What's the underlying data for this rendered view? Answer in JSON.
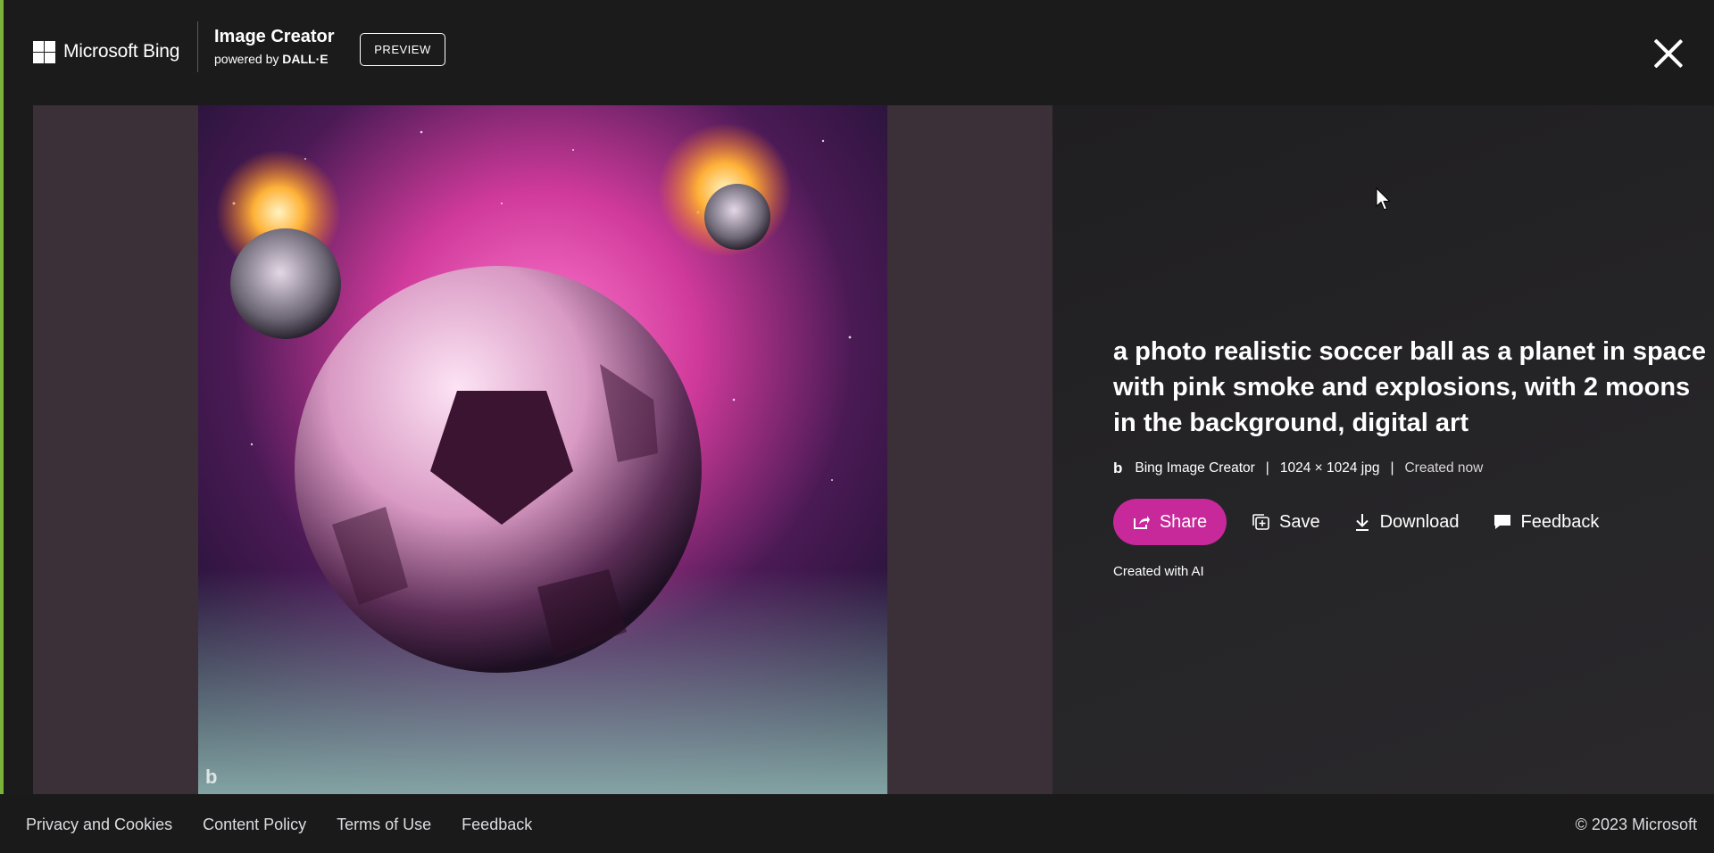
{
  "header": {
    "brand": "Microsoft Bing",
    "product_title": "Image Creator",
    "product_sub_prefix": "powered by ",
    "product_sub_brand": "DALL·E",
    "preview_badge": "PREVIEW"
  },
  "image": {
    "watermark": "b"
  },
  "details": {
    "prompt": "a photo realistic soccer ball as a planet in space with pink smoke and explosions, with 2 moons in the background, digital art",
    "meta": {
      "source": "Bing Image Creator",
      "separator": "|",
      "dimensions": "1024 × 1024 jpg",
      "created": "Created now"
    },
    "actions": {
      "share": "Share",
      "save": "Save",
      "download": "Download",
      "feedback": "Feedback"
    },
    "ai_note": "Created with AI"
  },
  "footer": {
    "links": [
      "Privacy and Cookies",
      "Content Policy",
      "Terms of Use",
      "Feedback"
    ],
    "copyright": "© 2023 Microsoft"
  },
  "colors": {
    "accent": "#c7289a",
    "background": "#1c1b1c",
    "stage": "#3b2f38"
  }
}
